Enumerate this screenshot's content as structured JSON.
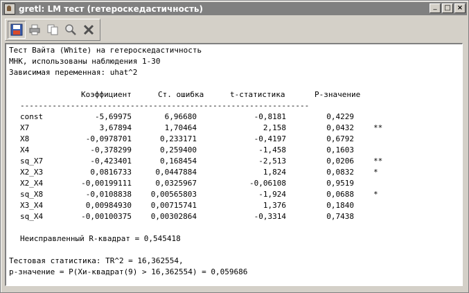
{
  "window": {
    "title": "gretl: LM тест (гетероскедастичность)",
    "buttons": {
      "minimize": "_",
      "maximize": "□",
      "close": "×"
    }
  },
  "toolbar": {
    "icons": [
      "save-icon",
      "print-icon",
      "copy-icon",
      "find-icon",
      "close-icon"
    ]
  },
  "output": {
    "header": [
      "Тест Вайта (White) на гетероскедастичность",
      "МНК, использованы наблюдения 1-30",
      "Зависимая переменная: uhat^2"
    ],
    "columns": [
      "Коэффициент",
      "Ст. ошибка",
      "t-статистика",
      "P-значение"
    ],
    "separator": "---------------------------------------------------------------",
    "rows": [
      {
        "name": "const",
        "coef": "-5,69975",
        "se": "6,96680",
        "t": "-0,8181",
        "p": "0,4229",
        "stars": ""
      },
      {
        "name": "X7",
        "coef": "3,67894",
        "se": "1,70464",
        "t": "2,158",
        "p": "0,0432",
        "stars": "**"
      },
      {
        "name": "X8",
        "coef": "-0,0978701",
        "se": "0,233171",
        "t": "-0,4197",
        "p": "0,6792",
        "stars": ""
      },
      {
        "name": "X4",
        "coef": "-0,378299",
        "se": "0,259400",
        "t": "-1,458",
        "p": "0,1603",
        "stars": ""
      },
      {
        "name": "sq_X7",
        "coef": "-0,423401",
        "se": "0,168454",
        "t": "-2,513",
        "p": "0,0206",
        "stars": "**"
      },
      {
        "name": "X2_X3",
        "coef": "0,0816733",
        "se": "0,0447884",
        "t": "1,824",
        "p": "0,0832",
        "stars": "*"
      },
      {
        "name": "X2_X4",
        "coef": "-0,00199111",
        "se": "0,0325967",
        "t": "-0,06108",
        "p": "0,9519",
        "stars": ""
      },
      {
        "name": "sq_X8",
        "coef": "-0,0108838",
        "se": "0,00565803",
        "t": "-1,924",
        "p": "0,0688",
        "stars": "*"
      },
      {
        "name": "X3_X4",
        "coef": "0,00984930",
        "se": "0,00715741",
        "t": "1,376",
        "p": "0,1840",
        "stars": ""
      },
      {
        "name": "sq_X4",
        "coef": "-0,00100375",
        "se": "0,00302864",
        "t": "-0,3314",
        "p": "0,7438",
        "stars": ""
      }
    ],
    "r_squared": "Неисправленный R-квадрат = 0,545418",
    "test_stat": "Тестовая статистика: TR^2 = 16,362554,",
    "p_value": "р-значение = P(Хи-квадрат(9) > 16,362554) = 0,059686"
  }
}
